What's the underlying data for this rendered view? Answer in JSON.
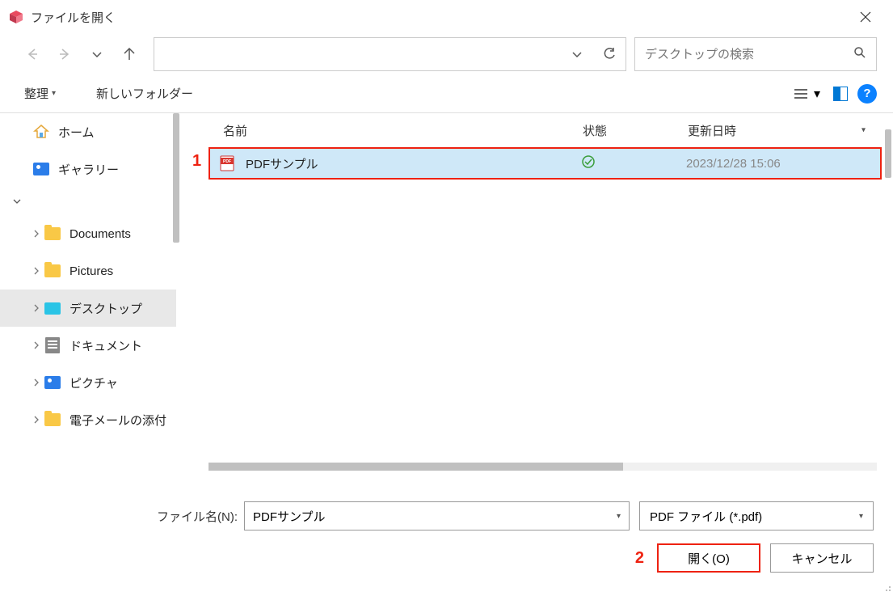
{
  "title": "ファイルを開く",
  "search": {
    "placeholder": "デスクトップの検索"
  },
  "toolbar": {
    "organize": "整理",
    "new_folder": "新しいフォルダー"
  },
  "sidebar": {
    "items": [
      {
        "label": "ホーム",
        "icon": "home"
      },
      {
        "label": "ギャラリー",
        "icon": "pic"
      }
    ],
    "tree": [
      {
        "label": "Documents",
        "icon": "folder"
      },
      {
        "label": "Pictures",
        "icon": "folder"
      },
      {
        "label": "デスクトップ",
        "icon": "desktop",
        "selected": true
      },
      {
        "label": "ドキュメント",
        "icon": "doc"
      },
      {
        "label": "ピクチャ",
        "icon": "pic"
      },
      {
        "label": "電子メールの添付",
        "icon": "folder"
      }
    ]
  },
  "columns": {
    "name": "名前",
    "status": "状態",
    "date": "更新日時"
  },
  "files": [
    {
      "name": "PDFサンプル",
      "status": "ok",
      "date": "2023/12/28 15:06"
    }
  ],
  "annotations": {
    "one": "1",
    "two": "2"
  },
  "bottom": {
    "filename_label": "ファイル名(N):",
    "filename_value": "PDFサンプル",
    "filetype": "PDF ファイル (*.pdf)",
    "open": "開く(O)",
    "cancel": "キャンセル"
  }
}
